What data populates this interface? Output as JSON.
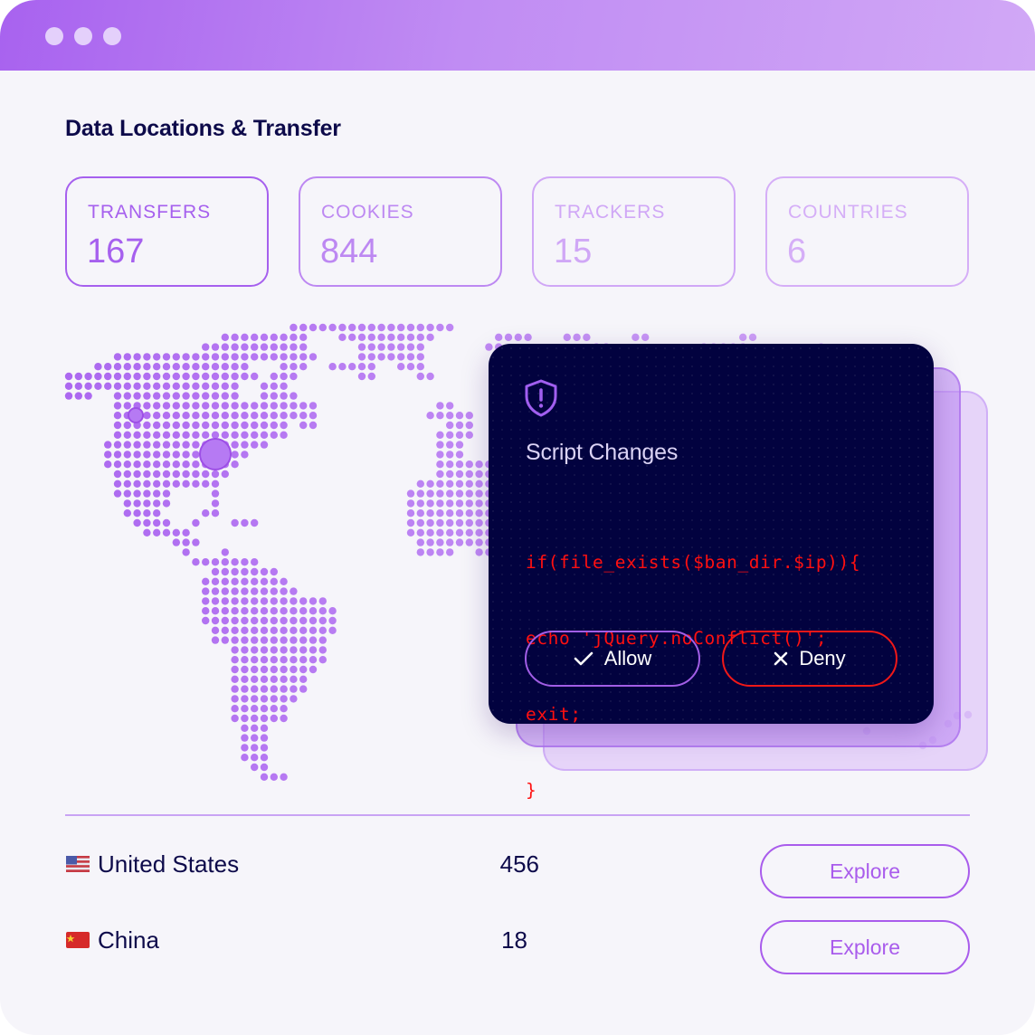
{
  "window": {
    "title_dots": [
      "window-dot-1",
      "window-dot-2",
      "window-dot-3"
    ]
  },
  "page": {
    "title": "Data Locations & Transfer"
  },
  "stats": [
    {
      "label": "TRANSFERS",
      "value": "167",
      "color": "#a660ee"
    },
    {
      "label": "COOKIES",
      "value": "844",
      "color": "#bd88f2"
    },
    {
      "label": "TRACKERS",
      "value": "15",
      "color": "#d0a7f6"
    },
    {
      "label": "COUNTRIES",
      "value": "6",
      "color": "#d5aef7"
    }
  ],
  "map": {
    "description": "dotted world map",
    "markers": [
      {
        "name": "west-coast-marker",
        "size": "small"
      },
      {
        "name": "central-us-marker",
        "size": "large"
      }
    ],
    "dot_color": "#b47cf1",
    "marker_color": "#b67af3"
  },
  "modal": {
    "icon": "shield-alert-icon",
    "title": "Script Changes",
    "code_lines": [
      "if(file_exists($ban_dir.$ip)){",
      "echo 'jQuery.noConflict()';",
      "exit;",
      "}"
    ],
    "allow_label": "Allow",
    "deny_label": "Deny",
    "allow_color": "#a25ee6",
    "deny_color": "#f01818",
    "background": "#02023f"
  },
  "countries": [
    {
      "flag": "us-flag-icon",
      "name": "United States",
      "count": "456",
      "action": "Explore"
    },
    {
      "flag": "cn-flag-icon",
      "name": "China",
      "count": "18",
      "action": "Explore"
    }
  ],
  "colors": {
    "accent": "#a95cec",
    "text_dark": "#0d0a4a",
    "background": "#f6f5fa"
  }
}
